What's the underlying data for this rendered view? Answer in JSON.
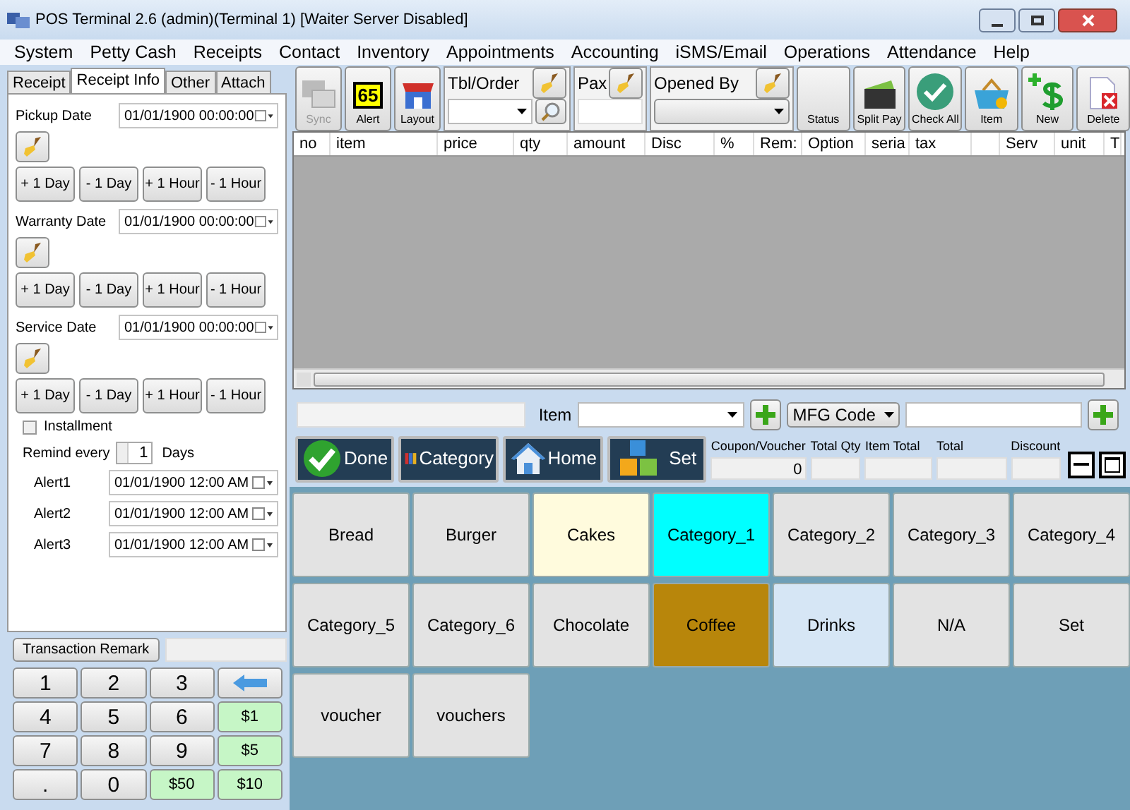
{
  "window": {
    "title": "POS Terminal 2.6 (admin)(Terminal 1) [Waiter Server Disabled]"
  },
  "menu": [
    "System",
    "Petty Cash",
    "Receipts",
    "Contact",
    "Inventory",
    "Appointments",
    "Accounting",
    "iSMS/Email",
    "Operations",
    "Attendance",
    "Help"
  ],
  "left_tabs": [
    {
      "label": "Receipt",
      "selected": false
    },
    {
      "label": "Receipt Info",
      "selected": true
    },
    {
      "label": "Other",
      "selected": false
    },
    {
      "label": "Attach",
      "selected": false
    }
  ],
  "date_groups": [
    {
      "label": "Pickup Date",
      "value": "01/01/1900 00:00:00",
      "buttons": [
        "+ 1 Day",
        "- 1 Day",
        "+ 1 Hour",
        "- 1 Hour"
      ]
    },
    {
      "label": "Warranty Date",
      "value": "01/01/1900 00:00:00",
      "buttons": [
        "+ 1 Day",
        "- 1 Day",
        "+ 1 Hour",
        "- 1 Hour"
      ]
    },
    {
      "label": "Service Date",
      "value": "01/01/1900 00:00:00",
      "buttons": [
        "+ 1 Day",
        "- 1 Day",
        "+ 1 Hour",
        "- 1 Hour"
      ]
    }
  ],
  "installment": {
    "label": "Installment",
    "checked": false
  },
  "remind": {
    "label": "Remind every",
    "value": "1",
    "unit": "Days"
  },
  "alerts": [
    {
      "label": "Alert1",
      "value": "01/01/1900 12:00 AM"
    },
    {
      "label": "Alert2",
      "value": "01/01/1900 12:00 AM"
    },
    {
      "label": "Alert3",
      "value": "01/01/1900 12:00 AM"
    }
  ],
  "transaction_remark": "Transaction Remark",
  "keypad": [
    {
      "kind": "digit",
      "label": "1"
    },
    {
      "kind": "digit",
      "label": "2"
    },
    {
      "kind": "digit",
      "label": "3"
    },
    {
      "kind": "back"
    },
    {
      "kind": "digit",
      "label": "4"
    },
    {
      "kind": "digit",
      "label": "5"
    },
    {
      "kind": "digit",
      "label": "6"
    },
    {
      "kind": "money",
      "label": "$1"
    },
    {
      "kind": "digit",
      "label": "7"
    },
    {
      "kind": "digit",
      "label": "8"
    },
    {
      "kind": "digit",
      "label": "9"
    },
    {
      "kind": "money",
      "label": "$5"
    },
    {
      "kind": "digit",
      "label": "."
    },
    {
      "kind": "digit",
      "label": "0"
    },
    {
      "kind": "money",
      "label": "$50"
    },
    {
      "kind": "money",
      "label": "$10"
    }
  ],
  "toolbar_left": [
    {
      "kind": "sync",
      "label": "Sync",
      "disabled": true
    },
    {
      "kind": "alert",
      "label": "Alert",
      "badge": "65",
      "disabled": false
    },
    {
      "kind": "layout",
      "label": "Layout",
      "disabled": false
    }
  ],
  "tbl_order": {
    "label": "Tbl/Order"
  },
  "pax": {
    "label": "Pax"
  },
  "opened_by": {
    "label": "Opened By"
  },
  "toolbar_right": [
    {
      "kind": "status",
      "label": "Status"
    },
    {
      "kind": "splitpay",
      "label": "Split Pay"
    },
    {
      "kind": "checkall",
      "label": "Check All"
    },
    {
      "kind": "item",
      "label": "Item"
    },
    {
      "kind": "new",
      "label": "New"
    },
    {
      "kind": "delete",
      "label": "Delete"
    }
  ],
  "table": {
    "columns": [
      "no",
      "item",
      "price",
      "qty",
      "amount",
      "Disc",
      "%",
      "Rem:",
      "Option",
      "seria",
      "tax",
      "",
      "Serv",
      "unit",
      "T"
    ]
  },
  "item_bar": {
    "label": "Item",
    "code_select": "MFG Code"
  },
  "actions": [
    {
      "kind": "done",
      "label": "Done"
    },
    {
      "kind": "category",
      "label": "Category"
    },
    {
      "kind": "home",
      "label": "Home"
    },
    {
      "kind": "set",
      "label": "Set"
    }
  ],
  "totals": [
    {
      "label": "Coupon/Voucher",
      "value": "0"
    },
    {
      "label": "Total Qty"
    },
    {
      "label": "Item Total"
    },
    {
      "label": "Total"
    },
    {
      "label": "Discount"
    }
  ],
  "categories": [
    {
      "label": "Bread",
      "color": "#e3e3e3"
    },
    {
      "label": "Burger",
      "color": "#e3e3e3"
    },
    {
      "label": "Cakes",
      "color": "#fffbdd"
    },
    {
      "label": "Category_1",
      "color": "#00ffff"
    },
    {
      "label": "Category_2",
      "color": "#e3e3e3"
    },
    {
      "label": "Category_3",
      "color": "#e3e3e3"
    },
    {
      "label": "Category_4",
      "color": "#e3e3e3"
    },
    {
      "label": "Category_5",
      "color": "#e3e3e3"
    },
    {
      "label": "Category_6",
      "color": "#e3e3e3"
    },
    {
      "label": "Chocolate",
      "color": "#e3e3e3"
    },
    {
      "label": "Coffee",
      "color": "#b8860b"
    },
    {
      "label": "Drinks",
      "color": "#d6e6f5"
    },
    {
      "label": "N/A",
      "color": "#e3e3e3"
    },
    {
      "label": "Set",
      "color": "#e3e3e3"
    },
    {
      "label": "voucher",
      "color": "#e3e3e3"
    },
    {
      "label": "vouchers",
      "color": "#e3e3e3"
    }
  ]
}
